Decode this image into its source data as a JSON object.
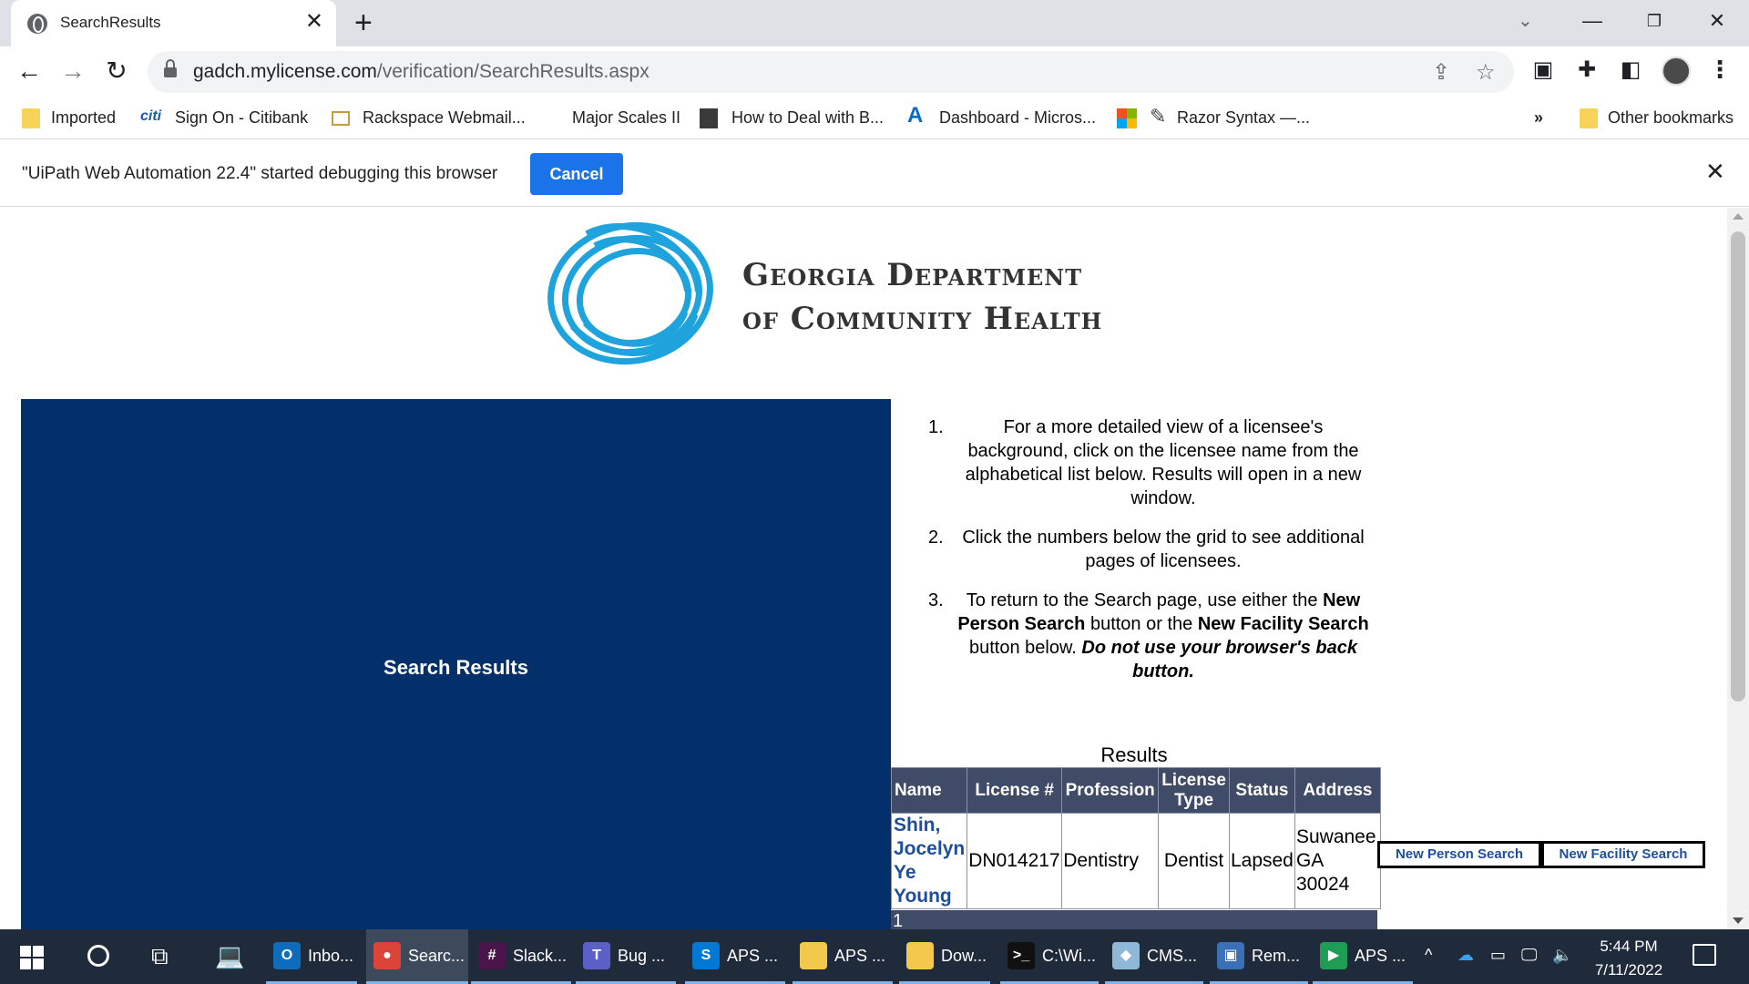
{
  "browser": {
    "tab_title": "SearchResults",
    "url_host": "gadch.mylicense.com",
    "url_path": "/verification/SearchResults.aspx",
    "bookmarks": [
      "Imported",
      "Sign On - Citibank",
      "Rackspace Webmail...",
      "Major Scales II",
      "How to Deal with B...",
      "Dashboard - Micros...",
      "Razor Syntax —...",
      "Other bookmarks"
    ],
    "bookmarks_overflow": "»",
    "infobar_text": "\"UiPath Web Automation 22.4\" started debugging this browser",
    "infobar_cancel": "Cancel",
    "citi_logo": "citi"
  },
  "page": {
    "logo_line1": "Georgia Department",
    "logo_line2": "of Community Health",
    "side_title": "Search Results",
    "instructions": {
      "n1": "1.",
      "t1": "For a more detailed view of a licensee's background, click on the licensee name from the alphabetical list below. Results will open in a new window.",
      "n2": "2.",
      "t2": "Click the numbers below the grid to see additional pages of licensees.",
      "n3": "3.",
      "t3a": "To return to the Search page, use either the ",
      "t3b": "New Person Search",
      "t3c": " button or the ",
      "t3d": "New Facility Search",
      "t3e": " button below. ",
      "t3f": "Do not use your browser's back button."
    },
    "results_caption": "Results",
    "table": {
      "headers": [
        "Name",
        "License #",
        "Profession",
        "License Type",
        "Status",
        "Address"
      ],
      "row": {
        "name": "Shin, Jocelyn Ye Young",
        "license": "DN014217",
        "profession": "Dentistry",
        "license_type": "Dentist",
        "status": "Lapsed",
        "address_line1": "Suwanee",
        "address_line2": "GA",
        "address_line3": "30024"
      },
      "pager": "1"
    },
    "new_person_search": "New Person Search",
    "new_facility_search": "New Facility Search"
  },
  "taskbar": {
    "items": [
      {
        "label": "Inbo...",
        "icon": "outlook-icon",
        "color": "#0f6cbd",
        "glyph": "O"
      },
      {
        "label": "Searc...",
        "icon": "chrome-icon",
        "color": "#db4437",
        "glyph": "●"
      },
      {
        "label": "Slack...",
        "icon": "slack-icon",
        "color": "#4a154b",
        "glyph": "#"
      },
      {
        "label": "Bug ...",
        "icon": "teams-icon",
        "color": "#5b5fc7",
        "glyph": "T"
      },
      {
        "label": "APS ...",
        "icon": "sharepoint-icon",
        "color": "#0078d4",
        "glyph": "S"
      },
      {
        "label": "APS ...",
        "icon": "folder-icon",
        "color": "#f2c94c",
        "glyph": ""
      },
      {
        "label": "Dow...",
        "icon": "folder-icon",
        "color": "#f2c94c",
        "glyph": ""
      },
      {
        "label": "C:\\Wi...",
        "icon": "cmd-icon",
        "color": "#111111",
        "glyph": ">_"
      },
      {
        "label": "CMS...",
        "icon": "cms-icon",
        "color": "#8fb8d8",
        "glyph": "◆"
      },
      {
        "label": "Rem...",
        "icon": "remote-desktop-icon",
        "color": "#3b6fb6",
        "glyph": "▣"
      },
      {
        "label": "APS ...",
        "icon": "media-icon",
        "color": "#1f9d55",
        "glyph": "▶"
      }
    ],
    "time": "5:44 PM",
    "date": "7/11/2022"
  },
  "colors": {
    "side_panel": "#03306b",
    "table_header": "#404b67",
    "link": "#1f4e9a",
    "cancel_button": "#1a73e8",
    "logo_blue": "#1ea3dc"
  }
}
